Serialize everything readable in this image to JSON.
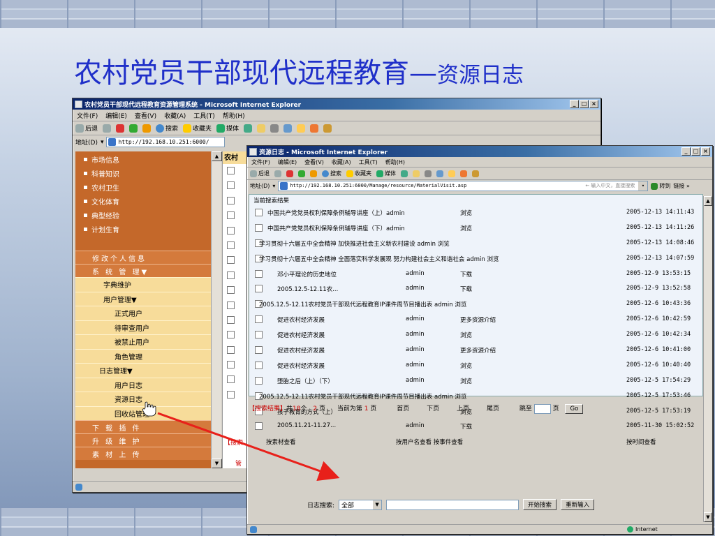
{
  "slide": {
    "title_main": "农村党员干部现代远程教育—",
    "title_sub": "资源日志"
  },
  "win1": {
    "title": "农村党员干部现代远程教育资源管理系统 - Microsoft Internet Explorer",
    "menu": [
      "文件(F)",
      "编辑(E)",
      "查看(V)",
      "收藏(A)",
      "工具(T)",
      "帮助(H)"
    ],
    "toolbar": {
      "back": "后退",
      "search": "搜索",
      "favorites": "收藏夹",
      "media": "媒体"
    },
    "address_label": "地址(D)",
    "address": "http://192.168.10.251:6000/",
    "sidebar_items": [
      "市场信息",
      "科普知识",
      "农村卫生",
      "文化体育",
      "典型经验",
      "计划生育"
    ],
    "orange_menu": [
      "修改个人信息",
      "系 统 管 理▼"
    ],
    "yellow_menu": [
      {
        "label": "字典维护",
        "indent": 1
      },
      {
        "label": "用户管理▼",
        "indent": 1
      },
      {
        "label": "正式用户",
        "indent": 2
      },
      {
        "label": "待审查用户",
        "indent": 2
      },
      {
        "label": "被禁止用户",
        "indent": 2
      },
      {
        "label": "角色管理",
        "indent": 2
      },
      {
        "label": "日志管理▼",
        "indent": 0
      },
      {
        "label": "用户日志",
        "indent": 2
      },
      {
        "label": "资源日志",
        "indent": 2
      },
      {
        "label": "回收站管理",
        "indent": 2
      }
    ],
    "bottom_menu": [
      "下 载 插 件",
      "升 级 维 护",
      "素 材 上 传"
    ],
    "column_header": "农村𝟐",
    "search_frag": "【搜索",
    "mgmt_frag": "管"
  },
  "win2": {
    "title": "资源日志 - Microsoft Internet Explorer",
    "menu": [
      "文件(F)",
      "编辑(E)",
      "查看(V)",
      "收藏(A)",
      "工具(T)",
      "帮助(H)"
    ],
    "toolbar": {
      "back": "后退",
      "search": "搜索",
      "favorites": "收藏夹",
      "media": "媒体"
    },
    "address_label": "地址(D)",
    "address": "http://192.168.10.251:6000/Manage/resource/MaterialVisit.asp",
    "address_hint": "← 输入中文，直接搜索",
    "go": "转到",
    "links": "链接 »",
    "list_title": "当前搜索结果",
    "rows": [
      {
        "kind": "normal",
        "title": "中国共产党党员权利保障条例辅导讲座（上）admin",
        "user": "",
        "action": "浏览",
        "date": "2005-12-13 14:11:43"
      },
      {
        "kind": "normal",
        "title": "中国共产党党员权利保障条例辅导讲座（下）admin",
        "user": "",
        "action": "浏览",
        "date": "2005-12-13 14:11:26"
      },
      {
        "kind": "long",
        "title": "学习贯彻十六届五中全会精神 加快推进社会主义新农村建设 admin   浏览",
        "user": "",
        "action": "",
        "date": "2005-12-13 14:08:46"
      },
      {
        "kind": "long",
        "title": "学习贯彻十六届五中全会精神 全面落实科学发展观 努力构建社会主义和谐社会 admin   浏览",
        "user": "",
        "action": "",
        "date": "2005-12-13 14:07:59"
      },
      {
        "kind": "sub",
        "title": "邓小平理论的历史地位",
        "user": "admin",
        "action": "下载",
        "date": "2005-12-9 13:53:15"
      },
      {
        "kind": "sub",
        "title": "2005.12.5-12.11农...",
        "user": "admin",
        "action": "下载",
        "date": "2005-12-9 13:52:58"
      },
      {
        "kind": "long",
        "title": "2005.12.5-12.11农村党员干部现代远程教育IP课件周节目播出表 admin   浏览",
        "user": "",
        "action": "",
        "date": "2005-12-6 10:43:36"
      },
      {
        "kind": "sub",
        "title": "促进农村经济发展",
        "user": "admin",
        "action": "更多资源介绍",
        "date": "2005-12-6 10:42:59"
      },
      {
        "kind": "sub",
        "title": "促进农村经济发展",
        "user": "admin",
        "action": "浏览",
        "date": "2005-12-6 10:42:34"
      },
      {
        "kind": "sub",
        "title": "促进农村经济发展",
        "user": "admin",
        "action": "更多资源介绍",
        "date": "2005-12-6 10:41:00"
      },
      {
        "kind": "sub",
        "title": "促进农村经济发展",
        "user": "admin",
        "action": "浏览",
        "date": "2005-12-6 10:40:40"
      },
      {
        "kind": "sub",
        "title": "堕胎之后（上）（下）",
        "user": "admin",
        "action": "浏览",
        "date": "2005-12-5 17:54:29"
      },
      {
        "kind": "long",
        "title": "2005.12.5-12.11农村党员干部现代远程教育IP课件周节目播出表 admin   浏览",
        "user": "",
        "action": "",
        "date": "2005-12-5 17:53:46"
      },
      {
        "kind": "sub",
        "title": "孩子教育的方式（上）",
        "user": "",
        "action": "浏览",
        "date": "2005-12-5 17:53:19"
      },
      {
        "kind": "sub",
        "title": "2005.11.21-11.27...",
        "user": "admin",
        "action": "下载",
        "date": "2005-11-30 15:02:52"
      }
    ],
    "query_by": {
      "village": "按素材查看",
      "user_event": "按用户名查看  按事件查看",
      "time": "按时间查看"
    },
    "pager": {
      "result_label": "【搜索结果】",
      "total_pre": "共",
      "total": "18",
      "total_mid": "个",
      "pages": "2",
      "pages_unit": "页",
      "current_pre": "当前为第",
      "current": "1",
      "current_unit": "页",
      "first": "首页",
      "prev": "下页",
      "next": "上页",
      "last": "尾页",
      "jump": "跳至",
      "jump_unit": "页",
      "go": "Go"
    },
    "search": {
      "label": "日志搜索:",
      "select": "全部",
      "start": "开始搜索",
      "reset": "重新输入"
    },
    "status": "Internet"
  },
  "colors": {
    "title_blue": "#1f2fc9",
    "sidebar_orange": "#c4682a",
    "menu_yellow": "#f7dc9a",
    "arrow_red": "#e8201a"
  }
}
